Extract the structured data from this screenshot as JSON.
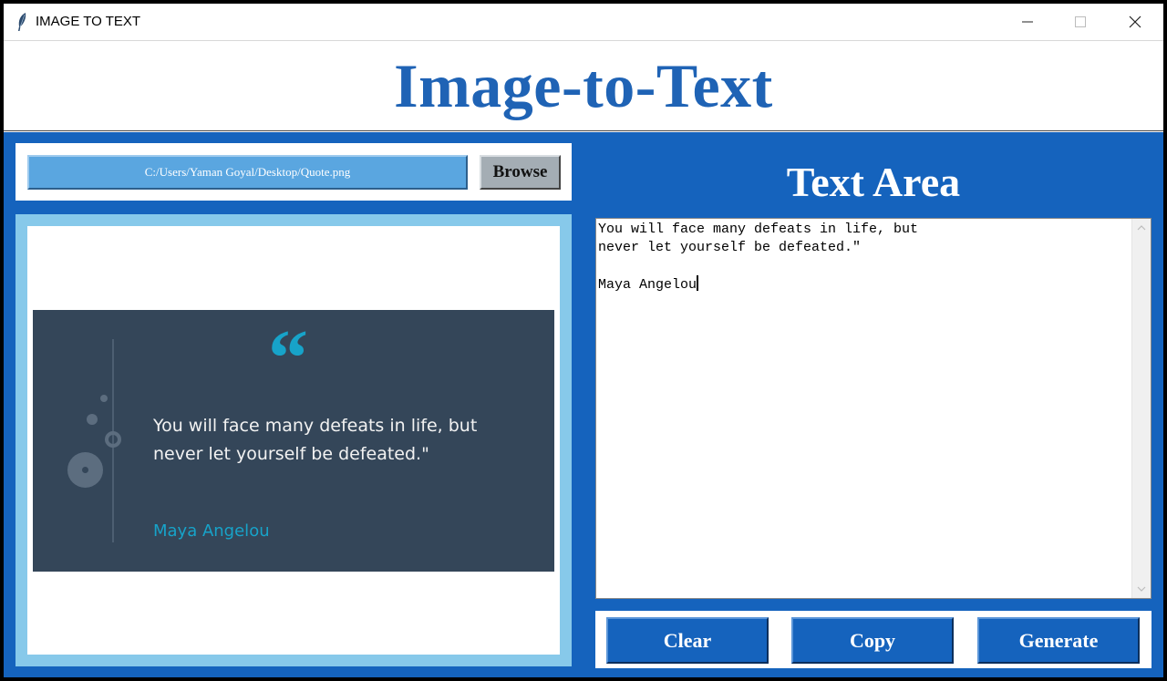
{
  "window": {
    "title": "IMAGE TO TEXT",
    "icon": "feather-icon"
  },
  "header": {
    "title": "Image-to-Text"
  },
  "file": {
    "path": "C:/Users/Yaman Goyal/Desktop/Quote.png",
    "browse_label": "Browse"
  },
  "preview": {
    "quote_mark": "“",
    "quote_line1": "You will face many defeats in life, but",
    "quote_line2": "never let yourself be defeated.\"",
    "author": "Maya Angelou"
  },
  "text_area": {
    "title": "Text Area",
    "content": "You will face many defeats in life, but\nnever let yourself be defeated.\"\n\nMaya Angelou"
  },
  "actions": {
    "clear_label": "Clear",
    "copy_label": "Copy",
    "generate_label": "Generate"
  },
  "colors": {
    "brand_blue": "#1563bd",
    "header_text": "#1f63b5",
    "path_field": "#5aa6e0",
    "image_border": "#87c9ea",
    "quote_card": "#344659",
    "quote_accent": "#17a3c9"
  }
}
